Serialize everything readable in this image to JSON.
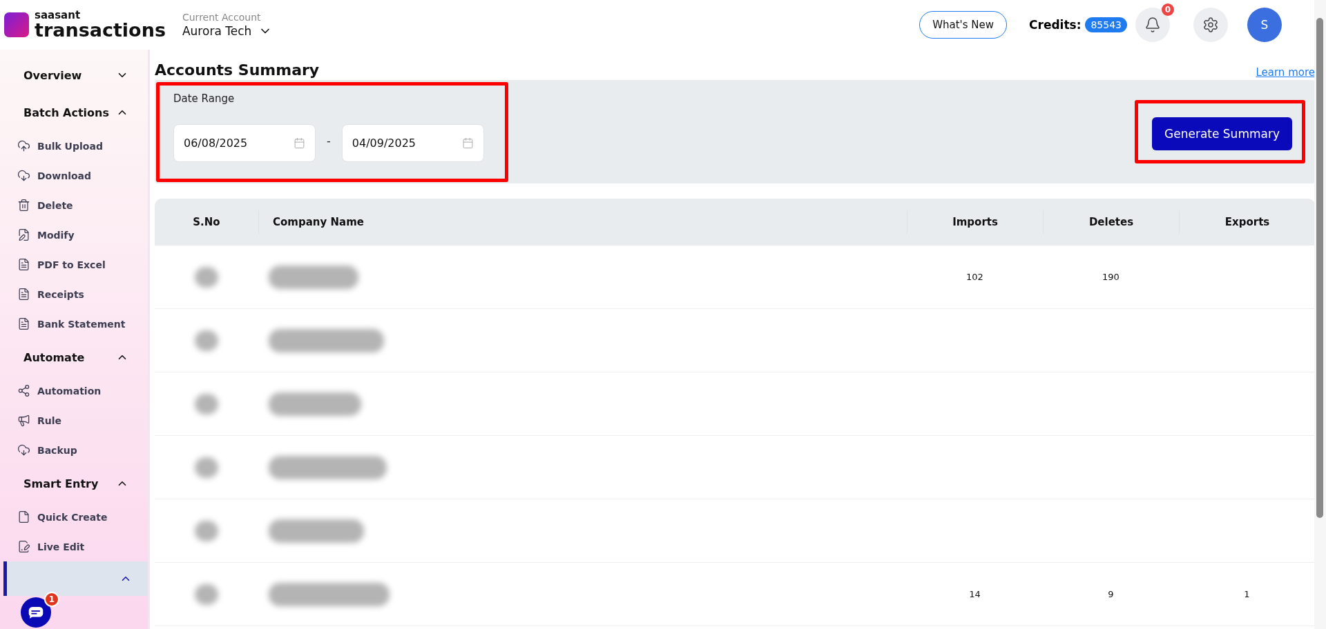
{
  "header": {
    "brand_top": "saasant",
    "brand_main": "transactions",
    "account_label": "Current Account",
    "account_name": "Aurora Tech",
    "whats_new": "What's New",
    "credits_label": "Credits:",
    "credits_value": "85543",
    "notification_count": "0",
    "avatar_initial": "S"
  },
  "sidebar": {
    "sections": [
      {
        "label": "Overview",
        "expanded": false,
        "selected": false
      },
      {
        "label": "Batch Actions",
        "expanded": true,
        "selected": false,
        "items": [
          {
            "label": "Bulk Upload"
          },
          {
            "label": "Download"
          },
          {
            "label": "Delete"
          },
          {
            "label": "Modify"
          },
          {
            "label": "PDF to Excel"
          },
          {
            "label": "Receipts"
          },
          {
            "label": "Bank Statement"
          }
        ]
      },
      {
        "label": "Automate",
        "expanded": true,
        "selected": false,
        "items": [
          {
            "label": "Automation"
          },
          {
            "label": "Rule"
          },
          {
            "label": "Backup"
          }
        ]
      },
      {
        "label": "Smart Entry",
        "expanded": true,
        "selected": false,
        "items": [
          {
            "label": "Quick Create"
          },
          {
            "label": "Live Edit"
          }
        ]
      },
      {
        "expanded": true,
        "selected": true
      }
    ]
  },
  "page": {
    "title": "Accounts Summary",
    "learn_more": "Learn more"
  },
  "filter": {
    "label": "Date Range",
    "from": "06/08/2025",
    "separator": "-",
    "to": "04/09/2025",
    "button": "Generate Summary",
    "highlighted": true
  },
  "table": {
    "columns": [
      "S.No",
      "Company Name",
      "Imports",
      "Deletes",
      "Exports"
    ],
    "rows": [
      {
        "redacted": true,
        "imports": "102",
        "deletes": "190"
      },
      {
        "redacted": true
      },
      {
        "redacted": true
      },
      {
        "redacted": true
      },
      {
        "redacted": true
      },
      {
        "redacted": true,
        "imports": "14",
        "deletes": "9",
        "exports": "1"
      }
    ]
  },
  "chat": {
    "badge": "1"
  }
}
